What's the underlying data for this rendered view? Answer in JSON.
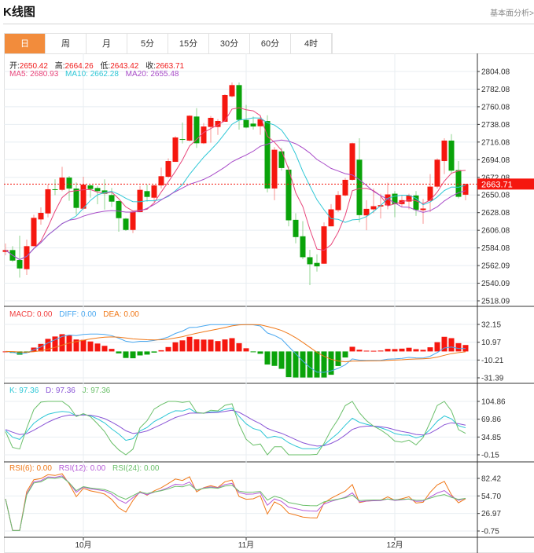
{
  "header": {
    "title": "K线图",
    "link": "基本面分析>"
  },
  "tabs": [
    {
      "label": "日",
      "active": true
    },
    {
      "label": "周"
    },
    {
      "label": "月"
    },
    {
      "label": "5分"
    },
    {
      "label": "15分"
    },
    {
      "label": "30分"
    },
    {
      "label": "60分"
    },
    {
      "label": "4时"
    }
  ],
  "ohlc_legend": {
    "open_label": "开:",
    "open": "2650.42",
    "high_label": "高:",
    "high": "2664.26",
    "low_label": "低:",
    "low": "2643.42",
    "close_label": "收:",
    "close": "2663.71"
  },
  "ma_legend": {
    "ma5": "MA5: 2680.93",
    "ma10": "MA10: 2662.28",
    "ma20": "MA20: 2655.48"
  },
  "macd_legend": {
    "macd": "MACD: 0.00",
    "diff": "DIFF: 0.00",
    "dea": "DEA: 0.00"
  },
  "kdj_legend": {
    "k": "K: 97.36",
    "d": "D: 97.36",
    "j": "J: 97.36"
  },
  "rsi_legend": {
    "rsi6": "RSI(6): 0.00",
    "rsi12": "RSI(12): 0.00",
    "rsi24": "RSI(24): 0.00"
  },
  "colors": {
    "up": "#f5170f",
    "down": "#0aa30a",
    "ma5": "#e8457a",
    "ma10": "#2ec7d6",
    "ma20": "#a84bc8",
    "diff": "#4aa8f0",
    "dea": "#f07818",
    "k": "#2ec7d6",
    "d": "#8a55d6",
    "j": "#6abf69",
    "rsi6": "#f07818",
    "rsi12": "#b65bd8",
    "rsi24": "#6abf69",
    "tab_active": "#f28c3c"
  },
  "chart_data": [
    {
      "type": "candlestick",
      "name": "main",
      "last_price": "2663.71",
      "yticks": [
        "2804.08",
        "2782.08",
        "2760.08",
        "2738.08",
        "2716.08",
        "2694.08",
        "2672.08",
        "2650.08",
        "2628.08",
        "2606.08",
        "2584.08",
        "2562.09",
        "2540.09",
        "2518.09"
      ],
      "ylim": [
        2518.09,
        2804.08
      ],
      "xticks": [
        {
          "label": "10月",
          "index": 11
        },
        {
          "label": "11月",
          "index": 34
        },
        {
          "label": "12月",
          "index": 55
        }
      ],
      "candles": [
        [
          2579.1,
          2589.6,
          2574.9,
          2581.4
        ],
        [
          2581.4,
          2586.3,
          2566.7,
          2568.3
        ],
        [
          2569.0,
          2599.4,
          2547.1,
          2558.5
        ],
        [
          2557.6,
          2594.5,
          2550.4,
          2586.3
        ],
        [
          2586.3,
          2625.5,
          2586.0,
          2621.6
        ],
        [
          2619.6,
          2634.6,
          2613.1,
          2627.8
        ],
        [
          2627.1,
          2663.0,
          2622.2,
          2657.2
        ],
        [
          2657.2,
          2669.6,
          2650.0,
          2656.2
        ],
        [
          2656.5,
          2685.2,
          2654.9,
          2671.8
        ],
        [
          2671.8,
          2673.8,
          2642.8,
          2658.1
        ],
        [
          2658.1,
          2665.6,
          2625.5,
          2634.0
        ],
        [
          2633.0,
          2672.8,
          2632.0,
          2663.0
        ],
        [
          2662.0,
          2663.0,
          2646.7,
          2657.5
        ],
        [
          2658.8,
          2661.4,
          2638.5,
          2654.9
        ],
        [
          2655.8,
          2669.6,
          2632.0,
          2651.6
        ],
        [
          2650.0,
          2658.8,
          2635.3,
          2641.8
        ],
        [
          2642.5,
          2643.4,
          2604.3,
          2621.2
        ],
        [
          2620.6,
          2621.6,
          2605.2,
          2606.5
        ],
        [
          2606.5,
          2630.4,
          2602.6,
          2629.4
        ],
        [
          2628.7,
          2661.4,
          2628.7,
          2656.5
        ],
        [
          2654.9,
          2663.0,
          2641.8,
          2647.7
        ],
        [
          2646.7,
          2663.0,
          2641.8,
          2662.0
        ],
        [
          2662.0,
          2684.2,
          2658.1,
          2673.5
        ],
        [
          2672.8,
          2695.7,
          2671.2,
          2692.4
        ],
        [
          2691.4,
          2723.4,
          2691.4,
          2721.8
        ],
        [
          2719.8,
          2740.4,
          2714.3,
          2719.2
        ],
        [
          2717.9,
          2749.5,
          2716.9,
          2748.9
        ],
        [
          2747.9,
          2758.4,
          2708.7,
          2714.6
        ],
        [
          2714.6,
          2739.8,
          2713.6,
          2735.5
        ],
        [
          2734.9,
          2748.6,
          2715.3,
          2746.3
        ],
        [
          2734.9,
          2744.7,
          2725.0,
          2742.4
        ],
        [
          2741.4,
          2775.7,
          2741.4,
          2774.7
        ],
        [
          2773.1,
          2790.4,
          2771.7,
          2787.1
        ],
        [
          2787.1,
          2790.4,
          2731.6,
          2743.7
        ],
        [
          2743.6,
          2762.5,
          2733.2,
          2734.2
        ],
        [
          2739.1,
          2747.9,
          2731.6,
          2735.5
        ],
        [
          2735.8,
          2747.9,
          2725.1,
          2744.6
        ],
        [
          2742.3,
          2749.5,
          2653.4,
          2658.2
        ],
        [
          2658.2,
          2709.7,
          2643.6,
          2706.5
        ],
        [
          2704.5,
          2708.7,
          2680.4,
          2683.7
        ],
        [
          2681.7,
          2685.9,
          2611.0,
          2618.5
        ],
        [
          2619.1,
          2627.3,
          2589.8,
          2597.6
        ],
        [
          2598.6,
          2617.5,
          2570.0,
          2572.5
        ],
        [
          2572.5,
          2581.7,
          2537.7,
          2563.7
        ],
        [
          2565.4,
          2576.1,
          2554.6,
          2561.1
        ],
        [
          2564.4,
          2615.9,
          2564.4,
          2611.0
        ],
        [
          2611.0,
          2638.7,
          2611.0,
          2632.2
        ],
        [
          2631.2,
          2655.0,
          2628.9,
          2650.1
        ],
        [
          2649.5,
          2671.3,
          2648.5,
          2669.0
        ],
        [
          2669.0,
          2715.3,
          2668.0,
          2714.6
        ],
        [
          2694.1,
          2720.8,
          2615.9,
          2625.0
        ],
        [
          2624.7,
          2643.6,
          2606.1,
          2632.8
        ],
        [
          2632.2,
          2658.2,
          2627.3,
          2636.1
        ],
        [
          2635.8,
          2651.7,
          2620.8,
          2637.4
        ],
        [
          2637.1,
          2665.4,
          2632.2,
          2650.8
        ],
        [
          2651.7,
          2655.0,
          2622.4,
          2638.7
        ],
        [
          2638.7,
          2650.1,
          2635.5,
          2643.6
        ],
        [
          2641.9,
          2651.7,
          2632.2,
          2649.5
        ],
        [
          2649.5,
          2655.0,
          2624.0,
          2631.5
        ],
        [
          2631.2,
          2645.2,
          2614.2,
          2633.2
        ],
        [
          2642.9,
          2676.2,
          2628.9,
          2660.5
        ],
        [
          2660.5,
          2695.7,
          2658.2,
          2694.1
        ],
        [
          2692.4,
          2720.8,
          2676.2,
          2717.9
        ],
        [
          2717.9,
          2726.0,
          2676.2,
          2680.4
        ],
        [
          2681.1,
          2692.4,
          2645.8,
          2647.8
        ],
        [
          2650.42,
          2664.26,
          2643.42,
          2663.71
        ]
      ]
    },
    {
      "type": "bar+line",
      "name": "MACD",
      "yticks": [
        "32.15",
        "10.97",
        "-10.21",
        "-31.39"
      ],
      "ylim": [
        -31.39,
        32.15
      ]
    },
    {
      "type": "line",
      "name": "KDJ",
      "yticks": [
        "104.86",
        "69.86",
        "34.85",
        "-0.15"
      ],
      "ylim": [
        -0.15,
        104.86
      ]
    },
    {
      "type": "line",
      "name": "RSI",
      "yticks": [
        "82.42",
        "54.70",
        "26.97",
        "-0.75"
      ],
      "ylim": [
        -0.75,
        82.42
      ]
    }
  ]
}
